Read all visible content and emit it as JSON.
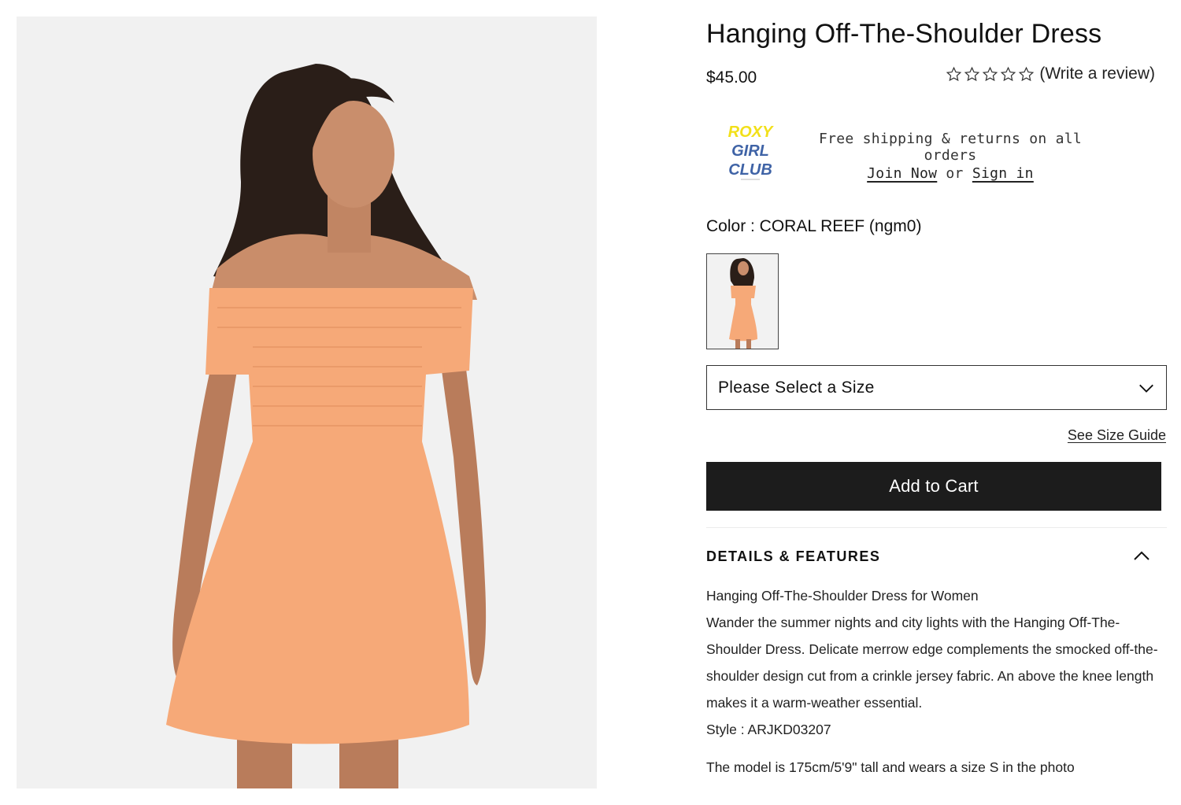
{
  "product": {
    "title": "Hanging Off-The-Shoulder Dress",
    "price": "$45.00",
    "rating_stars": 0,
    "review_link": "(Write a review)"
  },
  "club": {
    "logo_lines": [
      "ROXY",
      "GIRL",
      "CLUB"
    ],
    "shipping_text": "Free shipping & returns on all orders",
    "join_label": "Join Now",
    "or_text": "or",
    "signin_label": "Sign in"
  },
  "color": {
    "label": "Color : CORAL REEF (ngm0)"
  },
  "size": {
    "placeholder": "Please Select a Size",
    "guide_label": "See Size Guide"
  },
  "cart": {
    "label": "Add to Cart"
  },
  "details": {
    "heading": "DETAILS & FEATURES",
    "line1": "Hanging Off-The-Shoulder Dress for Women",
    "paragraph": "Wander the summer nights and city lights with the Hanging Off-The-Shoulder Dress. Delicate merrow edge complements the smocked off-the-shoulder design cut from a crinkle jersey fabric. An above the knee length makes it a warm-weather essential.",
    "style": "Style : ARJKD03207",
    "model_note": "The model is 175cm/5'9\" tall and wears a size S in the photo"
  },
  "colors": {
    "dress": "#f6a978",
    "background": "#f1f1f1",
    "button": "#1c1c1c",
    "logo_yellow": "#f2e01a",
    "logo_blue": "#3f63a6"
  }
}
